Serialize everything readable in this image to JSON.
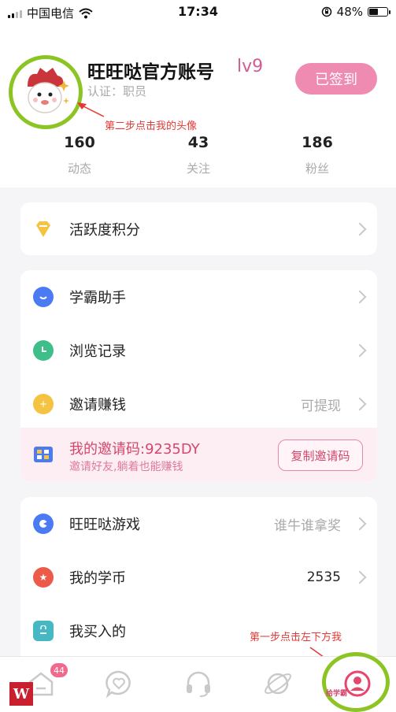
{
  "status_bar": {
    "carrier": "中国电信",
    "time": "17:34",
    "battery": "48%",
    "battery_fraction": 0.48
  },
  "profile": {
    "username": "旺旺哒官方账号",
    "level": "lv9",
    "certification": "认证：职员",
    "signin_button": "已签到",
    "annotation": "第二步点击我的头像",
    "stats": [
      {
        "num": "160",
        "label": "动态"
      },
      {
        "num": "43",
        "label": "关注"
      },
      {
        "num": "186",
        "label": "粉丝"
      }
    ]
  },
  "card1": {
    "items": [
      {
        "label": "活跃度积分",
        "icon": "diamond-icon",
        "color": "#f5c342"
      }
    ]
  },
  "card2": {
    "items": [
      {
        "label": "学霸助手",
        "icon": "chat-icon",
        "color": "#4a7bf2"
      },
      {
        "label": "浏览记录",
        "icon": "clock-icon",
        "color": "#3ebf8a"
      },
      {
        "label": "邀请赚钱",
        "value": "可提现",
        "icon": "moneybag-icon",
        "color": "#f5c342"
      }
    ],
    "invite": {
      "code_text": "我的邀请码:9235DY",
      "subtitle": "邀请好友,躺着也能赚钱",
      "copy_button": "复制邀请码"
    }
  },
  "card3": {
    "items": [
      {
        "label": "旺旺哒游戏",
        "value": "谁牛谁拿奖",
        "icon": "gamepad-icon",
        "color": "#4a7bf2"
      },
      {
        "label": "我的学币",
        "value": "2535",
        "icon": "coin-icon",
        "color": "#ec5a4a"
      },
      {
        "label": "我买入的",
        "icon": "bag-icon",
        "color": "#46b8c4"
      }
    ]
  },
  "annotation_step1": "第一步点击左下方我",
  "tabbar": {
    "badge": "44",
    "tabs": [
      {
        "name": "home-icon"
      },
      {
        "name": "message-heart-icon"
      },
      {
        "name": "headset-icon"
      },
      {
        "name": "planet-icon"
      },
      {
        "name": "me-icon"
      }
    ],
    "me_label": "给学霸",
    "watermark": "W"
  }
}
